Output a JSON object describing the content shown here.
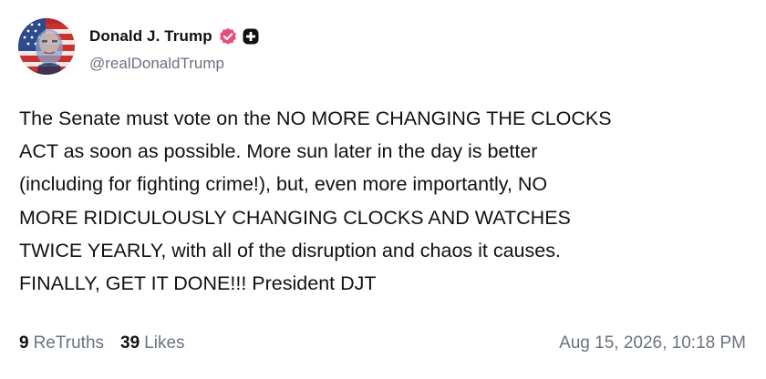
{
  "author": {
    "display_name": "Donald J. Trump",
    "handle": "@realDonaldTrump",
    "verified_icon": "verified-badge-icon",
    "plus_icon": "plus-badge-icon",
    "avatar_icon": "profile-avatar"
  },
  "post": {
    "text": "The Senate must vote on the NO MORE CHANGING THE CLOCKS\nACT as soon as possible. More sun later in the day is better\n(including for fighting crime!), but, even more importantly, NO\nMORE RIDICULOUSLY CHANGING CLOCKS AND WATCHES\nTWICE YEARLY, with all of the disruption and chaos it causes.\nFINALLY, GET IT DONE!!! President DJT"
  },
  "stats": {
    "retruths_count": "9",
    "retruths_label": "ReTruths",
    "likes_count": "39",
    "likes_label": "Likes"
  },
  "timestamp": "Aug 15, 2026, 10:18 PM",
  "colors": {
    "verified": "#e94b7a",
    "text": "#111111",
    "muted": "#6b7280"
  }
}
